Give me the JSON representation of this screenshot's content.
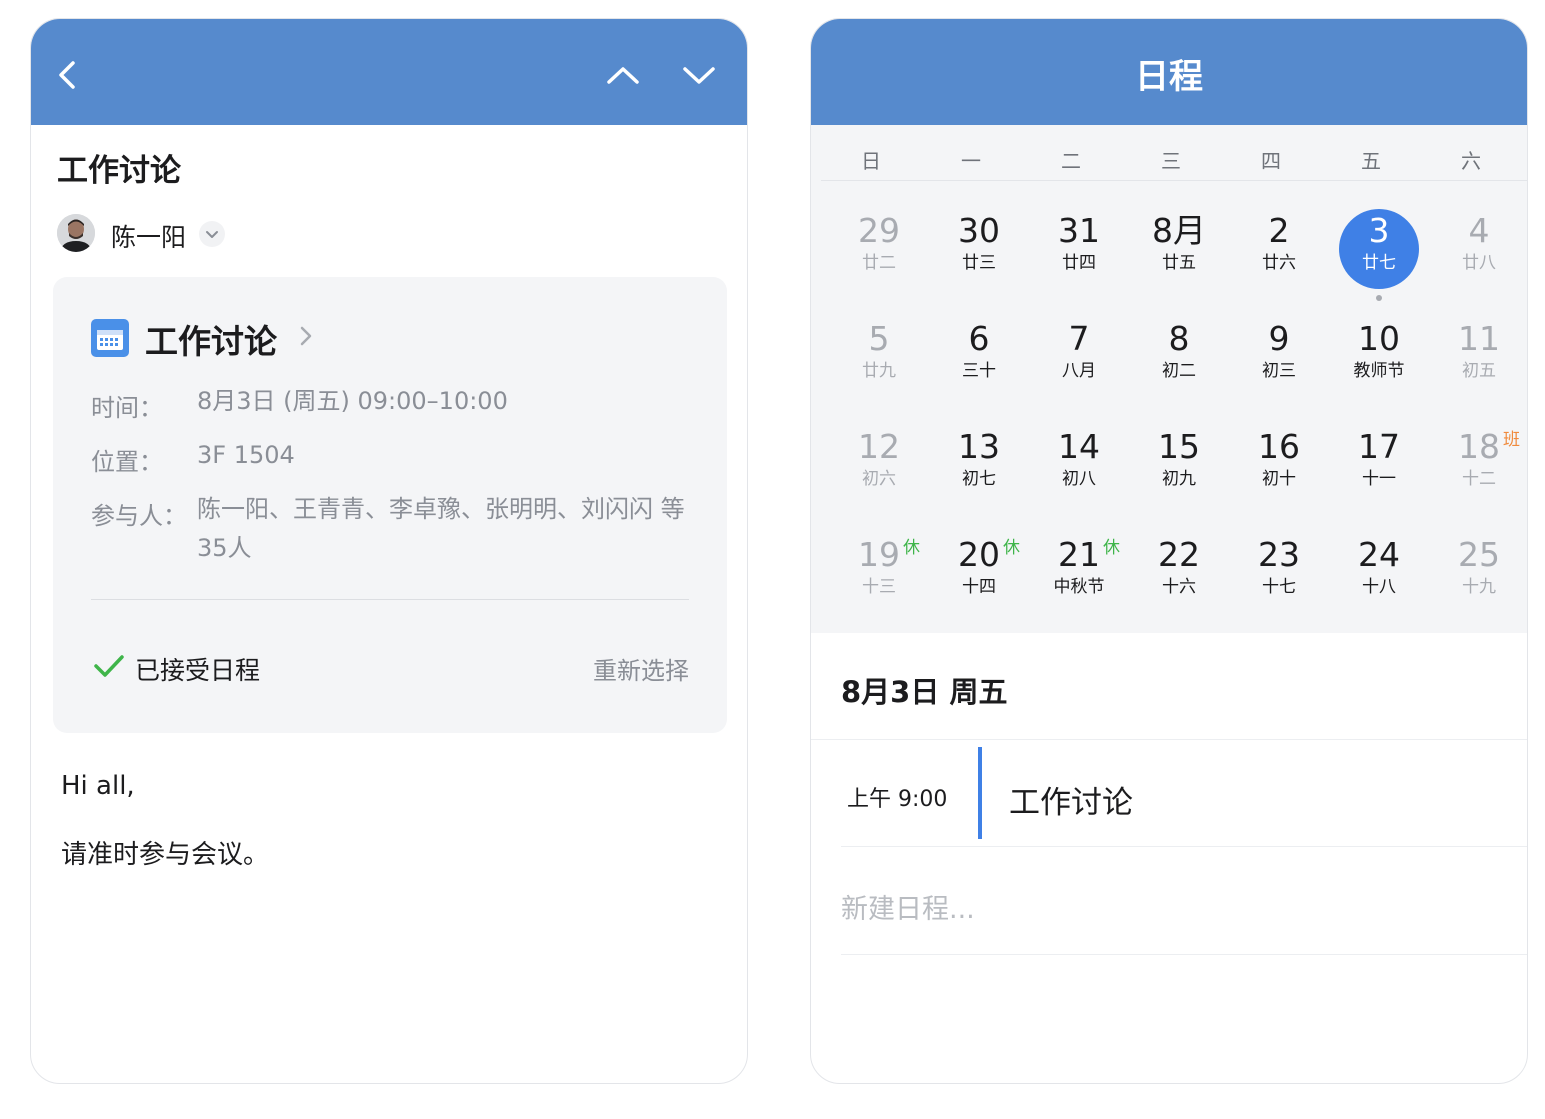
{
  "email": {
    "subject": "工作讨论",
    "sender": "陈一阳",
    "header_icons": [
      "back-icon",
      "chevron-up-icon",
      "chevron-down-icon"
    ],
    "invite": {
      "title": "工作讨论",
      "time_label": "时间：",
      "time_value": "8月3日 (周五) 09:00–10:00",
      "location_label": "位置：",
      "location_value": "3F 1504",
      "attendees_label": "参与人：",
      "attendees_value": "陈一阳、王青青、李卓豫、张明明、刘闪闪 等35人",
      "status": "已接受日程",
      "reselect": "重新选择"
    },
    "body": [
      "Hi all,",
      "请准时参与会议。"
    ]
  },
  "calendar": {
    "title": "日程",
    "weekdays": [
      "日",
      "一",
      "二",
      "三",
      "四",
      "五",
      "六"
    ],
    "weeks": [
      [
        {
          "num": "29",
          "sub": "廿二",
          "dim": true
        },
        {
          "num": "30",
          "sub": "廿三"
        },
        {
          "num": "31",
          "sub": "廿四"
        },
        {
          "num": "8月",
          "sub": "廿五"
        },
        {
          "num": "2",
          "sub": "廿六"
        },
        {
          "num": "3",
          "sub": "廿七",
          "selected": true,
          "dot": true
        },
        {
          "num": "4",
          "sub": "廿八",
          "dim": true
        }
      ],
      [
        {
          "num": "5",
          "sub": "廿九",
          "dim": true
        },
        {
          "num": "6",
          "sub": "三十"
        },
        {
          "num": "7",
          "sub": "八月"
        },
        {
          "num": "8",
          "sub": "初二"
        },
        {
          "num": "9",
          "sub": "初三"
        },
        {
          "num": "10",
          "sub": "教师节"
        },
        {
          "num": "11",
          "sub": "初五",
          "dim": true
        }
      ],
      [
        {
          "num": "12",
          "sub": "初六",
          "dim": true
        },
        {
          "num": "13",
          "sub": "初七"
        },
        {
          "num": "14",
          "sub": "初八"
        },
        {
          "num": "15",
          "sub": "初九"
        },
        {
          "num": "16",
          "sub": "初十"
        },
        {
          "num": "17",
          "sub": "十一"
        },
        {
          "num": "18",
          "sub": "十二",
          "dim": true,
          "tag": "班",
          "tag_type": "work"
        }
      ],
      [
        {
          "num": "19",
          "sub": "十三",
          "dim": true,
          "tag": "休",
          "tag_type": "rest"
        },
        {
          "num": "20",
          "sub": "十四",
          "tag": "休",
          "tag_type": "rest"
        },
        {
          "num": "21",
          "sub": "中秋节",
          "tag": "休",
          "tag_type": "rest"
        },
        {
          "num": "22",
          "sub": "十六"
        },
        {
          "num": "23",
          "sub": "十七"
        },
        {
          "num": "24",
          "sub": "十八"
        },
        {
          "num": "25",
          "sub": "十九",
          "dim": true
        }
      ]
    ],
    "selected_date": "8月3日 周五",
    "events": [
      {
        "time": "上午 9:00",
        "title": "工作讨论"
      }
    ],
    "new_event_placeholder": "新建日程..."
  },
  "colors": {
    "header": "#568acd",
    "accent": "#3f80e6",
    "rest": "#3fb54a",
    "work": "#f08a3c"
  }
}
